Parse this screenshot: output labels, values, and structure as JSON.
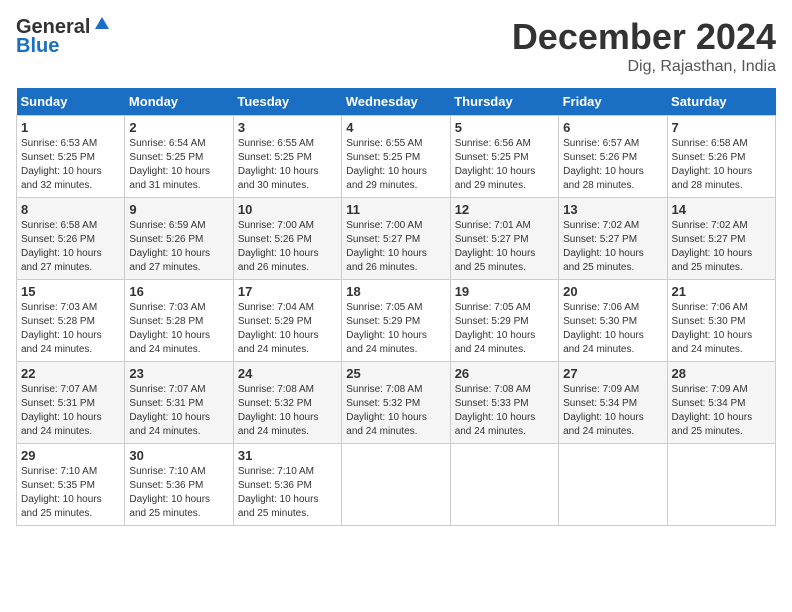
{
  "header": {
    "logo_general": "General",
    "logo_blue": "Blue",
    "title": "December 2024",
    "subtitle": "Dig, Rajasthan, India"
  },
  "days_of_week": [
    "Sunday",
    "Monday",
    "Tuesday",
    "Wednesday",
    "Thursday",
    "Friday",
    "Saturday"
  ],
  "weeks": [
    [
      {
        "day": "1",
        "sunrise": "6:53 AM",
        "sunset": "5:25 PM",
        "daylight": "10 hours and 32 minutes."
      },
      {
        "day": "2",
        "sunrise": "6:54 AM",
        "sunset": "5:25 PM",
        "daylight": "10 hours and 31 minutes."
      },
      {
        "day": "3",
        "sunrise": "6:55 AM",
        "sunset": "5:25 PM",
        "daylight": "10 hours and 30 minutes."
      },
      {
        "day": "4",
        "sunrise": "6:55 AM",
        "sunset": "5:25 PM",
        "daylight": "10 hours and 29 minutes."
      },
      {
        "day": "5",
        "sunrise": "6:56 AM",
        "sunset": "5:25 PM",
        "daylight": "10 hours and 29 minutes."
      },
      {
        "day": "6",
        "sunrise": "6:57 AM",
        "sunset": "5:26 PM",
        "daylight": "10 hours and 28 minutes."
      },
      {
        "day": "7",
        "sunrise": "6:58 AM",
        "sunset": "5:26 PM",
        "daylight": "10 hours and 28 minutes."
      }
    ],
    [
      {
        "day": "8",
        "sunrise": "6:58 AM",
        "sunset": "5:26 PM",
        "daylight": "10 hours and 27 minutes."
      },
      {
        "day": "9",
        "sunrise": "6:59 AM",
        "sunset": "5:26 PM",
        "daylight": "10 hours and 27 minutes."
      },
      {
        "day": "10",
        "sunrise": "7:00 AM",
        "sunset": "5:26 PM",
        "daylight": "10 hours and 26 minutes."
      },
      {
        "day": "11",
        "sunrise": "7:00 AM",
        "sunset": "5:27 PM",
        "daylight": "10 hours and 26 minutes."
      },
      {
        "day": "12",
        "sunrise": "7:01 AM",
        "sunset": "5:27 PM",
        "daylight": "10 hours and 25 minutes."
      },
      {
        "day": "13",
        "sunrise": "7:02 AM",
        "sunset": "5:27 PM",
        "daylight": "10 hours and 25 minutes."
      },
      {
        "day": "14",
        "sunrise": "7:02 AM",
        "sunset": "5:27 PM",
        "daylight": "10 hours and 25 minutes."
      }
    ],
    [
      {
        "day": "15",
        "sunrise": "7:03 AM",
        "sunset": "5:28 PM",
        "daylight": "10 hours and 24 minutes."
      },
      {
        "day": "16",
        "sunrise": "7:03 AM",
        "sunset": "5:28 PM",
        "daylight": "10 hours and 24 minutes."
      },
      {
        "day": "17",
        "sunrise": "7:04 AM",
        "sunset": "5:29 PM",
        "daylight": "10 hours and 24 minutes."
      },
      {
        "day": "18",
        "sunrise": "7:05 AM",
        "sunset": "5:29 PM",
        "daylight": "10 hours and 24 minutes."
      },
      {
        "day": "19",
        "sunrise": "7:05 AM",
        "sunset": "5:29 PM",
        "daylight": "10 hours and 24 minutes."
      },
      {
        "day": "20",
        "sunrise": "7:06 AM",
        "sunset": "5:30 PM",
        "daylight": "10 hours and 24 minutes."
      },
      {
        "day": "21",
        "sunrise": "7:06 AM",
        "sunset": "5:30 PM",
        "daylight": "10 hours and 24 minutes."
      }
    ],
    [
      {
        "day": "22",
        "sunrise": "7:07 AM",
        "sunset": "5:31 PM",
        "daylight": "10 hours and 24 minutes."
      },
      {
        "day": "23",
        "sunrise": "7:07 AM",
        "sunset": "5:31 PM",
        "daylight": "10 hours and 24 minutes."
      },
      {
        "day": "24",
        "sunrise": "7:08 AM",
        "sunset": "5:32 PM",
        "daylight": "10 hours and 24 minutes."
      },
      {
        "day": "25",
        "sunrise": "7:08 AM",
        "sunset": "5:32 PM",
        "daylight": "10 hours and 24 minutes."
      },
      {
        "day": "26",
        "sunrise": "7:08 AM",
        "sunset": "5:33 PM",
        "daylight": "10 hours and 24 minutes."
      },
      {
        "day": "27",
        "sunrise": "7:09 AM",
        "sunset": "5:34 PM",
        "daylight": "10 hours and 24 minutes."
      },
      {
        "day": "28",
        "sunrise": "7:09 AM",
        "sunset": "5:34 PM",
        "daylight": "10 hours and 25 minutes."
      }
    ],
    [
      {
        "day": "29",
        "sunrise": "7:10 AM",
        "sunset": "5:35 PM",
        "daylight": "10 hours and 25 minutes."
      },
      {
        "day": "30",
        "sunrise": "7:10 AM",
        "sunset": "5:36 PM",
        "daylight": "10 hours and 25 minutes."
      },
      {
        "day": "31",
        "sunrise": "7:10 AM",
        "sunset": "5:36 PM",
        "daylight": "10 hours and 25 minutes."
      },
      null,
      null,
      null,
      null
    ]
  ],
  "labels": {
    "sunrise": "Sunrise:",
    "sunset": "Sunset:",
    "daylight": "Daylight:"
  }
}
